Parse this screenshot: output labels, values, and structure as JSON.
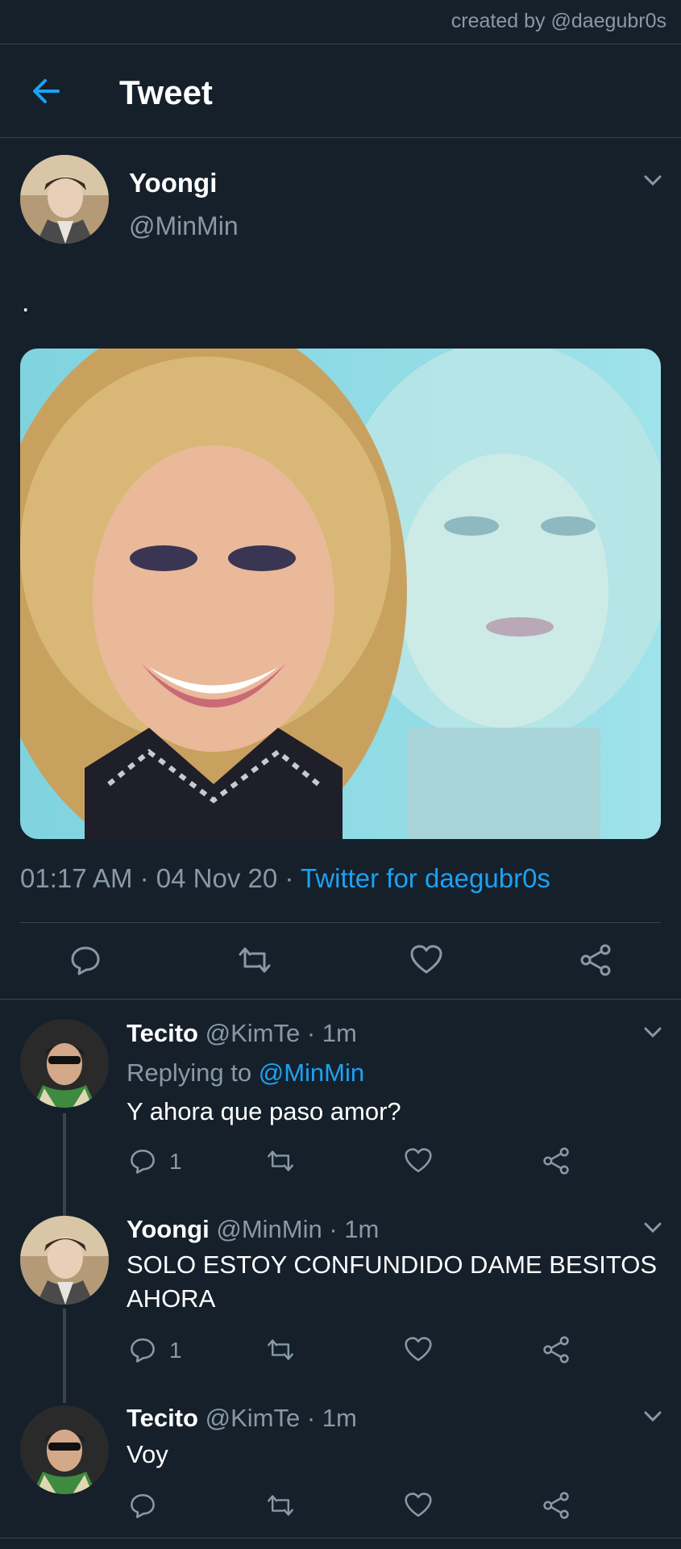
{
  "watermark": "created by @daegubr0s",
  "topbar": {
    "title": "Tweet",
    "back_icon": "arrow-left-icon"
  },
  "colors": {
    "background": "#15202b",
    "accent": "#1da1f2",
    "muted": "#8899a6",
    "divider": "#38444d"
  },
  "main_tweet": {
    "name": "Yoongi",
    "handle": "@MinMin",
    "text": ".",
    "time": "01:17 AM",
    "date": "04 Nov 20",
    "source": "Twitter for daegubr0s",
    "meta_sep": " · "
  },
  "replies": [
    {
      "name": "Tecito",
      "meta": " @KimTe · 1m",
      "replying_prefix": "Replying to ",
      "replying_to": "@MinMin",
      "text": "Y ahora que paso amor?",
      "reply_count": "1"
    },
    {
      "name": "Yoongi",
      "meta": " @MinMin · 1m",
      "text": "SOLO ESTOY CONFUNDIDO DAME BESITOS AHORA",
      "reply_count": "1"
    },
    {
      "name": "Tecito",
      "meta": " @KimTe · 1m",
      "text": "Voy"
    }
  ]
}
